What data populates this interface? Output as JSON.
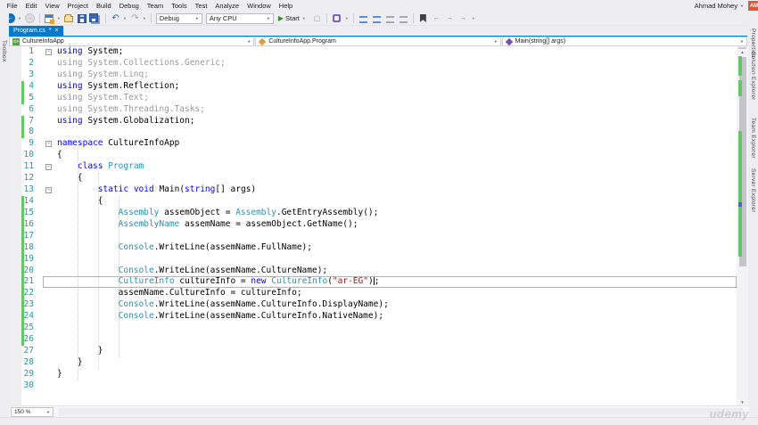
{
  "menu": {
    "items": [
      "File",
      "Edit",
      "View",
      "Project",
      "Build",
      "Debug",
      "Team",
      "Tools",
      "Test",
      "Analyze",
      "Window",
      "Help"
    ]
  },
  "account": {
    "name": "Ahmad Mohey",
    "avatar_initials": "AM"
  },
  "toolbar": {
    "debug_config": "Debug",
    "platform": "Any CPU",
    "start_label": "Start",
    "icons": [
      "back-icon",
      "forward-icon",
      "new-window-icon",
      "open-folder-icon",
      "save-icon",
      "save-all-icon",
      "undo-icon",
      "redo-icon",
      "start-play-icon",
      "attach-process-icon",
      "bookmark-icon",
      "comment-lines-icon"
    ]
  },
  "tab": {
    "title": "Program.cs",
    "modified": "*",
    "close": "×"
  },
  "navbar": {
    "project": "CultureInfoApp",
    "type": "CultureInfoApp.Program",
    "member": "Main(string[] args)"
  },
  "side_tabs": {
    "left": [
      "Toolbox"
    ],
    "right": [
      "Properties",
      "Solution Explorer",
      "Team Explorer",
      "Server Explorer"
    ]
  },
  "statusbar": {
    "zoom": "150 %"
  },
  "watermark": "udemy",
  "colors": {
    "accent_blue": "#007ACC",
    "keyword": "#0000FF",
    "type": "#2B91AF",
    "string": "#A31515",
    "inactive_code": "#95989E",
    "line_number": "#2B91AF",
    "change_bar": "#63C763",
    "caret_mark": "#5757E8",
    "avatar": "#E2572F"
  },
  "scrollbar": {
    "marks": [
      {
        "c": "#63C763",
        "t": 11,
        "h": 22
      },
      {
        "c": "#63C763",
        "t": 38,
        "h": 18
      },
      {
        "c": "#63C763",
        "t": 95,
        "h": 141
      },
      {
        "c": "#5757E8",
        "t": 175,
        "h": 5
      }
    ]
  },
  "code": {
    "current_line": 21,
    "change_bars": [
      {
        "from": 4,
        "to": 5
      },
      {
        "from": 7,
        "to": 8
      },
      {
        "from": 14,
        "to": 26
      }
    ],
    "guides": [
      {
        "col": 0,
        "from": 10,
        "to": 29
      },
      {
        "col": 4,
        "from": 12,
        "to": 28
      },
      {
        "col": 8,
        "from": 14,
        "to": 27
      }
    ],
    "lines": [
      {
        "n": 1,
        "fold": true,
        "ind": 0,
        "seg": [
          [
            "kw",
            "using"
          ],
          [
            "pl",
            " System;"
          ]
        ]
      },
      {
        "n": 2,
        "ind": 0,
        "seg": [
          [
            "gr",
            "using System.Collections.Generic;"
          ]
        ]
      },
      {
        "n": 3,
        "ind": 0,
        "seg": [
          [
            "gr",
            "using System.Linq;"
          ]
        ]
      },
      {
        "n": 4,
        "ind": 0,
        "seg": [
          [
            "kw",
            "using"
          ],
          [
            "pl",
            " System.Reflection;"
          ]
        ]
      },
      {
        "n": 5,
        "ind": 0,
        "seg": [
          [
            "gr",
            "using System.Text;"
          ]
        ]
      },
      {
        "n": 6,
        "ind": 0,
        "seg": [
          [
            "gr",
            "using System.Threading.Tasks;"
          ]
        ]
      },
      {
        "n": 7,
        "ind": 0,
        "seg": [
          [
            "kw",
            "using"
          ],
          [
            "pl",
            " System.Globalization;"
          ]
        ]
      },
      {
        "n": 8,
        "ind": 0,
        "seg": []
      },
      {
        "n": 9,
        "fold": true,
        "ind": 0,
        "seg": [
          [
            "kw",
            "namespace"
          ],
          [
            "pl",
            " CultureInfoApp"
          ]
        ]
      },
      {
        "n": 10,
        "ind": 0,
        "seg": [
          [
            "pl",
            "{"
          ]
        ]
      },
      {
        "n": 11,
        "fold": true,
        "ind": 4,
        "seg": [
          [
            "kw",
            "class"
          ],
          [
            "pl",
            " "
          ],
          [
            "ty",
            "Program"
          ]
        ]
      },
      {
        "n": 12,
        "ind": 4,
        "seg": [
          [
            "pl",
            "{"
          ]
        ]
      },
      {
        "n": 13,
        "fold": true,
        "ind": 8,
        "seg": [
          [
            "kw",
            "static"
          ],
          [
            "pl",
            " "
          ],
          [
            "kw",
            "void"
          ],
          [
            "pl",
            " Main("
          ],
          [
            "kw",
            "string"
          ],
          [
            "pl",
            "[] args)"
          ]
        ]
      },
      {
        "n": 14,
        "ind": 8,
        "seg": [
          [
            "pl",
            "{"
          ]
        ]
      },
      {
        "n": 15,
        "ind": 12,
        "seg": [
          [
            "ty",
            "Assembly"
          ],
          [
            "pl",
            " assemObject = "
          ],
          [
            "ty",
            "Assembly"
          ],
          [
            "pl",
            ".GetEntryAssembly();"
          ]
        ]
      },
      {
        "n": 16,
        "ind": 12,
        "seg": [
          [
            "ty",
            "AssemblyName"
          ],
          [
            "pl",
            " assemName = assemObject.GetName();"
          ]
        ]
      },
      {
        "n": 17,
        "ind": 0,
        "seg": []
      },
      {
        "n": 18,
        "ind": 12,
        "seg": [
          [
            "ty",
            "Console"
          ],
          [
            "pl",
            ".WriteLine(assemName.FullName);"
          ]
        ]
      },
      {
        "n": 19,
        "ind": 0,
        "seg": []
      },
      {
        "n": 20,
        "ind": 12,
        "seg": [
          [
            "ty",
            "Console"
          ],
          [
            "pl",
            ".WriteLine(assemName.CultureName);"
          ]
        ]
      },
      {
        "n": 21,
        "current": true,
        "ind": 12,
        "seg": [
          [
            "ty",
            "CultureInfo"
          ],
          [
            "pl",
            " cultureInfo = "
          ],
          [
            "kw",
            "new"
          ],
          [
            "pl",
            " "
          ],
          [
            "ty",
            "CultureInfo"
          ],
          [
            "pl",
            "("
          ],
          [
            "st",
            "\"ar-EG\""
          ],
          [
            "pl",
            ")"
          ],
          [
            "cr",
            ""
          ],
          [
            "pl",
            ";"
          ]
        ]
      },
      {
        "n": 22,
        "ind": 12,
        "seg": [
          [
            "pl",
            "assemName.CultureInfo = cultureInfo;"
          ]
        ]
      },
      {
        "n": 23,
        "ind": 12,
        "seg": [
          [
            "ty",
            "Console"
          ],
          [
            "pl",
            ".WriteLine(assemName.CultureInfo.DisplayName);"
          ]
        ]
      },
      {
        "n": 24,
        "ind": 12,
        "seg": [
          [
            "ty",
            "Console"
          ],
          [
            "pl",
            ".WriteLine(assemName.CultureInfo.NativeName);"
          ]
        ]
      },
      {
        "n": 25,
        "ind": 0,
        "seg": []
      },
      {
        "n": 26,
        "ind": 0,
        "seg": []
      },
      {
        "n": 27,
        "ind": 8,
        "seg": [
          [
            "pl",
            "}"
          ]
        ]
      },
      {
        "n": 28,
        "ind": 4,
        "seg": [
          [
            "pl",
            "}"
          ]
        ]
      },
      {
        "n": 29,
        "ind": 0,
        "seg": [
          [
            "pl",
            "}"
          ]
        ]
      },
      {
        "n": 30,
        "ind": 0,
        "seg": []
      }
    ]
  }
}
